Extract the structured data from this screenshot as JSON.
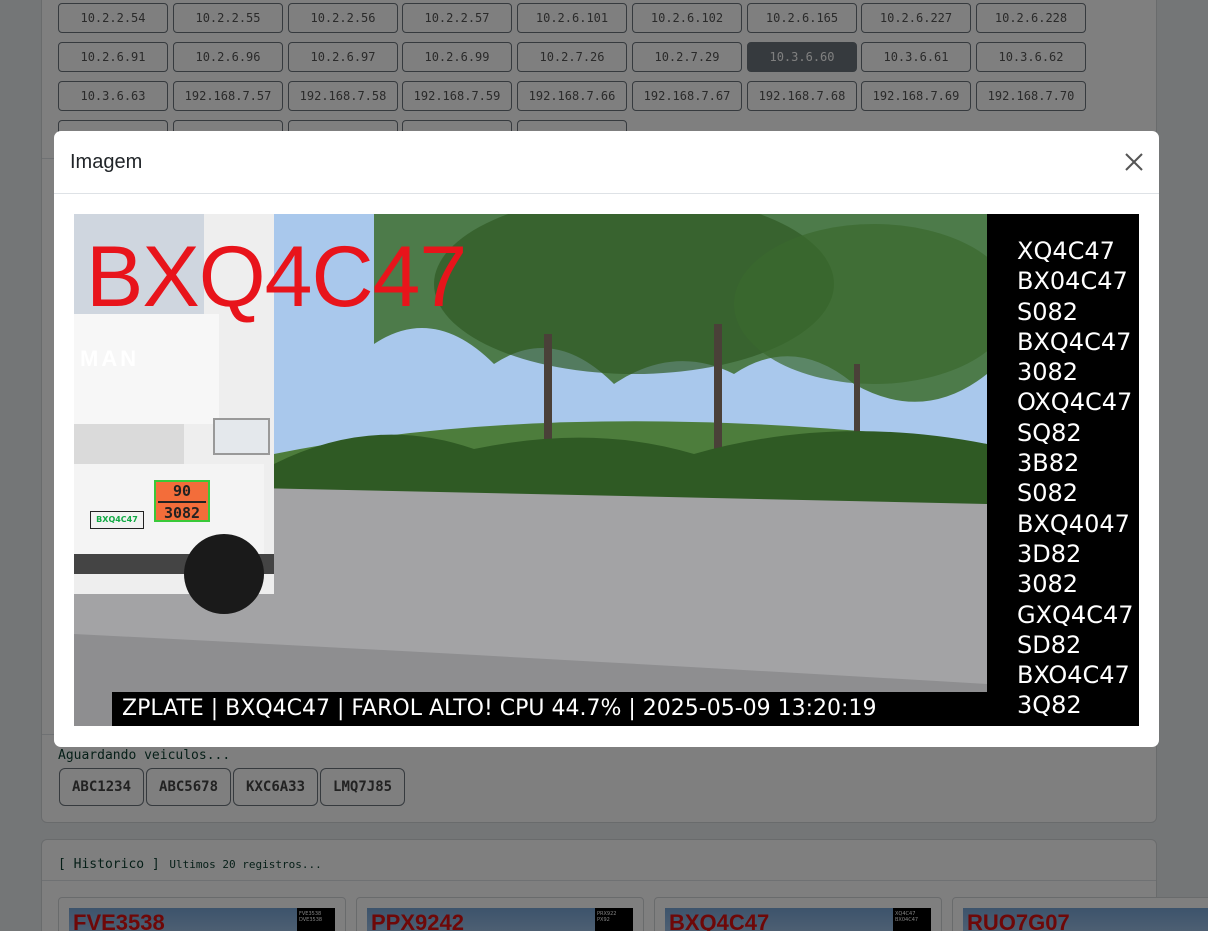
{
  "ip_buttons": [
    {
      "label": "10.2.2.54"
    },
    {
      "label": "10.2.2.55"
    },
    {
      "label": "10.2.2.56"
    },
    {
      "label": "10.2.2.57"
    },
    {
      "label": "10.2.6.101"
    },
    {
      "label": "10.2.6.102"
    },
    {
      "label": "10.2.6.165"
    },
    {
      "label": "10.2.6.227"
    },
    {
      "label": "10.2.6.228"
    },
    {
      "label": "10.2.6.91"
    },
    {
      "label": "10.2.6.96"
    },
    {
      "label": "10.2.6.97"
    },
    {
      "label": "10.2.6.99"
    },
    {
      "label": "10.2.7.26"
    },
    {
      "label": "10.2.7.29"
    },
    {
      "label": "10.3.6.60",
      "active": true
    },
    {
      "label": "10.3.6.61"
    },
    {
      "label": "10.3.6.62"
    },
    {
      "label": "10.3.6.63"
    },
    {
      "label": "192.168.7.57"
    },
    {
      "label": "192.168.7.58"
    },
    {
      "label": "192.168.7.59"
    },
    {
      "label": "192.168.7.66"
    },
    {
      "label": "192.168.7.67"
    },
    {
      "label": "192.168.7.68"
    },
    {
      "label": "192.168.7.69"
    },
    {
      "label": "192.168.7.70"
    },
    {
      "label": ""
    },
    {
      "label": ""
    },
    {
      "label": ""
    },
    {
      "label": ""
    },
    {
      "label": ""
    }
  ],
  "waiting_text": "Aguardando veiculos...",
  "plates": [
    "ABC1234",
    "ABC5678",
    "KXC6A33",
    "LMQ7J85"
  ],
  "history": {
    "title": "[ Historico ]",
    "subtitle": "Ultimos 20 registros...",
    "items": [
      {
        "plate": "FVE3538",
        "side": [
          "FVE3538",
          "DVE3538"
        ]
      },
      {
        "plate": "PPX9242",
        "side": [
          "PRX922",
          "PX92"
        ]
      },
      {
        "plate": "BXQ4C47",
        "side": [
          "XQ4C47",
          "BX04C47"
        ]
      },
      {
        "plate": "RUO7G07",
        "side": []
      }
    ]
  },
  "modal": {
    "title": "Imagem",
    "close_icon": "close-icon",
    "camera": {
      "plate": "BXQ4C47",
      "truck_logo": "MAN",
      "small_plate": "BXQ4C47",
      "hazard_top": "90",
      "hazard_bottom": "3082",
      "candidates": [
        "XQ4C47",
        "BX04C47",
        "S082",
        "BXQ4C47",
        "3082",
        "OXQ4C47",
        "SQ82",
        "3B82",
        "S082",
        "BXQ4047",
        "3D82",
        "3082",
        "GXQ4C47",
        "SD82",
        "BXO4C47",
        "3Q82"
      ],
      "status": "ZPLATE | BXQ4C47 | FAROL ALTO! CPU 44.7% | 2025-05-09 13:20:19"
    }
  },
  "colors": {
    "plate_red": "#e8141b",
    "active_button": "#6c757d",
    "backdrop": "rgba(0,0,0,0.5)"
  }
}
